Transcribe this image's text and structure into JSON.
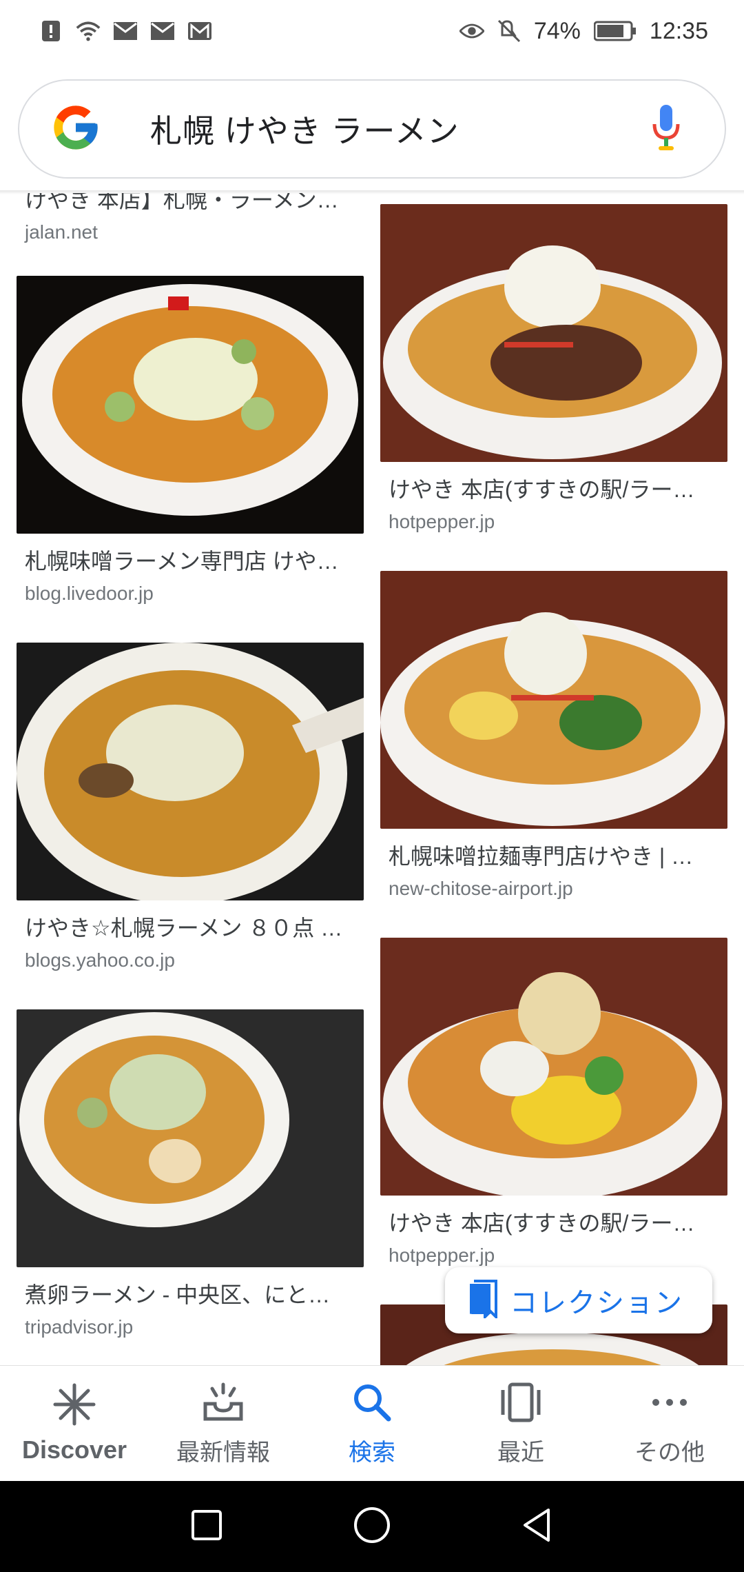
{
  "status_bar": {
    "battery": "74%",
    "time": "12:35",
    "icons": [
      "alert-icon",
      "wifi-icon",
      "mail-icon",
      "mail-icon",
      "gmail-icon",
      "eye-icon",
      "mute-icon",
      "battery-icon"
    ]
  },
  "search": {
    "query": "札幌 けやき ラーメン"
  },
  "results": [
    {
      "title": "けやき 本店】札幌・ラーメン…",
      "source": "jalan.net"
    },
    {
      "title": "札幌味噌ラーメン専門店 けや…",
      "source": "blog.livedoor.jp"
    },
    {
      "title": "けやき☆札幌ラーメン ８０点 …",
      "source": "blogs.yahoo.co.jp"
    },
    {
      "title": "煮卵ラーメン - 中央区、にと…",
      "source": "tripadvisor.jp"
    },
    {
      "title": "けやき 本店(すすきの駅/ラー…",
      "source": "hotpepper.jp"
    },
    {
      "title": "札幌味噌拉麺専門店けやき | …",
      "source": "new-chitose-airport.jp"
    },
    {
      "title": "けやき 本店(すすきの駅/ラー…",
      "source": "hotpepper.jp"
    }
  ],
  "collection_button": {
    "label": "コレクション"
  },
  "bottom_nav": [
    {
      "label": "Discover",
      "icon": "asterisk-icon"
    },
    {
      "label": "最新情報",
      "icon": "inbox-tray-icon"
    },
    {
      "label": "検索",
      "icon": "search-icon",
      "active": true
    },
    {
      "label": "最近",
      "icon": "recent-cards-icon"
    },
    {
      "label": "その他",
      "icon": "more-dots-icon"
    }
  ],
  "colors": {
    "accent": "#1a73e8",
    "text": "#3c4043",
    "source": "#70757a"
  }
}
